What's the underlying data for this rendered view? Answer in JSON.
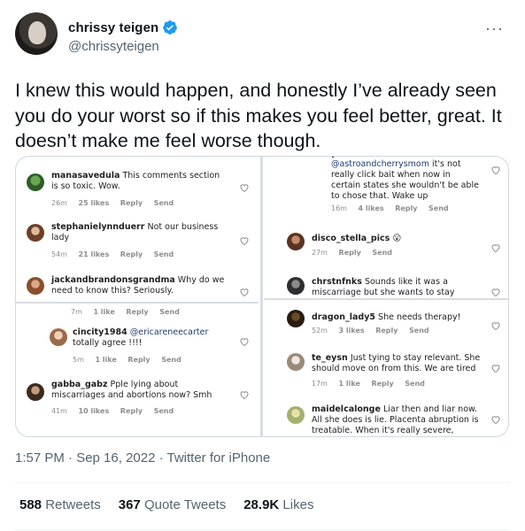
{
  "author": {
    "name": "chrissy teigen",
    "handle": "@chrissyteigen",
    "verified": true
  },
  "tweet": {
    "text": "I knew this would happen, and honestly I’ve already seen you do your worst so if this makes you feel better, great. It doesn’t make me feel worse though.",
    "timestamp": "1:57 PM · Sep 16, 2022 · Twitter for iPhone"
  },
  "stats": {
    "retweets_count": "588",
    "retweets_label": "Retweets",
    "quotes_count": "367",
    "quotes_label": "Quote Tweets",
    "likes_count": "28.9K",
    "likes_label": "Likes"
  },
  "colors": {
    "verified": "#1d9bf0",
    "text_primary": "#0f1419",
    "text_secondary": "#536471"
  },
  "comments_left": [
    {
      "user": "manasavedula",
      "text": "This comments section is so toxic. Wow.",
      "time": "26m",
      "likes": "25 likes",
      "reply": "Reply",
      "send": "Send"
    },
    {
      "user": "stephanielynnduerr",
      "text": "Not our business lady",
      "time": "54m",
      "likes": "21 likes",
      "reply": "Reply",
      "send": "Send"
    },
    {
      "user": "jackandbrandonsgrandma",
      "text": "Why do we need to know this? Seriously.",
      "time": "7m",
      "likes": "1 like",
      "reply": "Reply",
      "send": "Send"
    },
    {
      "user": "cincity1984",
      "mention": "@ericareneecarter",
      "text": "totally agree !!!!",
      "time": "5m",
      "likes": "1 like",
      "reply": "Reply",
      "send": "Send"
    },
    {
      "user": "gabba_gabz",
      "text": "Pple lying about miscarriages and abortions now? Smh",
      "time": "41m",
      "likes": "10 likes",
      "reply": "Reply",
      "send": "Send"
    }
  ],
  "comments_right": [
    {
      "user": "yellowwindows",
      "mention": "@astroandcherrysmom",
      "text": "it's not really click bait when now in certain states she wouldn't be able to chose that. Wake up",
      "time": "16m",
      "likes": "4 likes",
      "reply": "Reply",
      "send": "Send"
    },
    {
      "user": "disco_stella_pics",
      "emoji": "😮",
      "time": "27m",
      "reply": "Reply",
      "send": "Send"
    },
    {
      "user": "chrstnfnks",
      "text": "Sounds like it was a miscarriage but she wants to stay"
    },
    {
      "user": "dragon_lady5",
      "text": "She needs therapy!",
      "time": "52m",
      "likes": "3 likes",
      "reply": "Reply",
      "send": "Send"
    },
    {
      "user": "te_eysn",
      "text": "Just tying to stay relevant. She should move on from this. We are tired",
      "time": "17m",
      "likes": "1 like",
      "reply": "Reply",
      "send": "Send"
    },
    {
      "user": "maidelcalonge",
      "text": "Liar then and liar now. All she does is lie. Placenta abruption is treatable. When it's really severe, doctors"
    }
  ]
}
